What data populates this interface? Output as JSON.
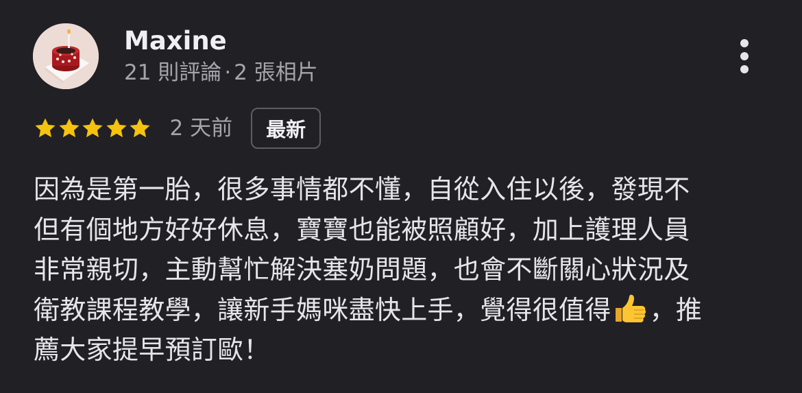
{
  "reviewer": {
    "name": "Maxine",
    "review_count": "21 則評論",
    "separator": "·",
    "photo_count": "2 張相片"
  },
  "rating": {
    "stars": 5,
    "star_color": "#f5c20f",
    "date": "2 天前",
    "badge_label": "最新"
  },
  "review": {
    "lines": [
      "因為是第一胎，很多事情都不懂，自從入住以後，發現不",
      "但有個地方好好休息，寶寶也能被照顧好，加上護理人員",
      "非常親切，主動幫忙解決塞奶問題，也會不斷關心狀況及",
      "衛教課程教學，讓新手媽咪盡快上手，覺得很值得",
      "，推",
      "薦大家提早預訂歐！"
    ],
    "emoji": "thumbs-up"
  },
  "colors": {
    "background": "#212025",
    "text_primary": "#f0f0f3",
    "text_secondary": "#a6a5ac",
    "badge_border": "#5e5d64"
  },
  "menu": {
    "icon": "more-vertical-icon"
  }
}
